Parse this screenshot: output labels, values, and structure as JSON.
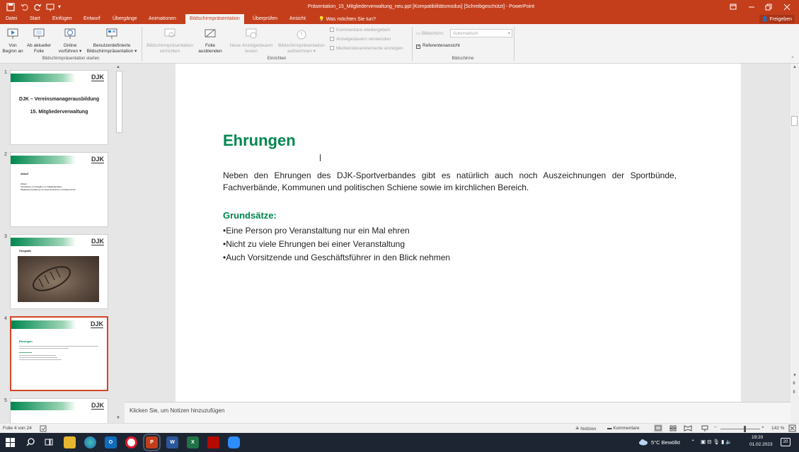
{
  "window": {
    "title": "Präsentation_15_Mitgliederverwaltung_neu.ppt [Kompatibilitätsmodus] [Schreibgeschützt] - PowerPoint"
  },
  "tabs": [
    {
      "label": "Datei"
    },
    {
      "label": "Start"
    },
    {
      "label": "Einfügen"
    },
    {
      "label": "Entwurf"
    },
    {
      "label": "Übergänge"
    },
    {
      "label": "Animationen"
    },
    {
      "label": "Bildschirmpräsentation",
      "active": true
    },
    {
      "label": "Überprüfen"
    },
    {
      "label": "Ansicht"
    },
    {
      "label": "Was möchten Sie tun?"
    }
  ],
  "share_label": "Freigeben",
  "ribbon": {
    "start_group": {
      "label": "Bildschirmpräsentation starten",
      "from_start": [
        "Von",
        "Beginn an"
      ],
      "from_current": [
        "Ab aktueller",
        "Folie"
      ],
      "online": [
        "Online",
        "vorführen ▾"
      ],
      "custom": [
        "Benutzerdefinierte",
        "Bildschirmpräsentation ▾"
      ]
    },
    "setup_group": {
      "label": "Einrichten",
      "setup": [
        "Bildschirmpräsentation",
        "einrichten"
      ],
      "hide": [
        "Folie",
        "ausblenden"
      ],
      "rehearse": [
        "Neue Anzeigedauern",
        "testen"
      ],
      "record": [
        "Bildschirmpräsentation",
        "aufzeichnen ▾"
      ],
      "checkboxes": [
        "Kommentare wiedergeben",
        "Anzeigedauern verwenden",
        "Mediensteuerelemente anzeigen"
      ]
    },
    "monitors_group": {
      "label": "Bildschirme",
      "monitor_label": "Bildschirm:",
      "monitor_value": "Automatisch",
      "presenter_view": "Referentenansicht"
    }
  },
  "thumbnails": [
    {
      "num": "1",
      "title": "DJK – Vereinsmanagerausbildung",
      "subtitle": "15. Mitgliederverwaltung"
    },
    {
      "num": "2",
      "heading": "Ablauf",
      "lines": [
        "Ablauf",
        "Verwaltung und Abgabe von Mitgliederdaten",
        "Mitgliederverwaltung mit Vereinssoftware und Datenschutz"
      ]
    },
    {
      "num": "3",
      "heading": "Fotografie"
    },
    {
      "num": "4",
      "heading": "Ehrungen"
    },
    {
      "num": "5"
    }
  ],
  "logo_text": "DJK",
  "slide": {
    "title": "Ehrungen",
    "body": "Neben den Ehrungen des DJK-Sportverbandes gibt es natürlich auch noch Auszeichnungen der Sportbünde, Fachverbände, Kommunen und politischen Schiene sowie im kirchlichen Bereich.",
    "subheading": "Grundsätze:",
    "bullets": [
      "•Eine Person pro Veranstaltung nur ein Mal ehren",
      "•Nicht zu viele Ehrungen bei einer Veranstaltung",
      "•Auch Vorsitzende und Geschäftsführer in den Blick nehmen"
    ]
  },
  "notes_placeholder": "Klicken Sie, um Notizen hinzuzufügen",
  "status": {
    "slide_info": "Folie 4 von 24",
    "notes": "Notizen",
    "comments": "Kommentare",
    "zoom": "142 %",
    "zoom_fraction": 0.6
  },
  "taskbar": {
    "weather": "5°C  Bewölkt",
    "time": "19:20",
    "date": "01.02.2023",
    "notifications": "20"
  },
  "colors": {
    "accent": "#c43e1c",
    "slide_green": "#00874f",
    "selected_thumb": "#d24726"
  }
}
